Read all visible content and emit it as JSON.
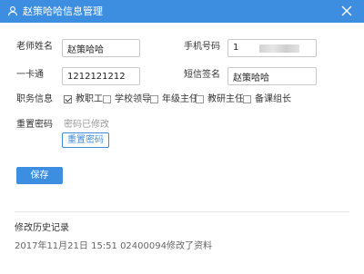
{
  "dialog": {
    "title": "赵策哈哈信息管理",
    "icons": {
      "title": "user-icon",
      "close": "close-icon"
    },
    "accent_color": "#3d8ee0"
  },
  "form": {
    "teacher_name": {
      "label": "老师姓名",
      "value": "赵策哈哈"
    },
    "phone": {
      "label": "手机号码",
      "value": "1"
    },
    "card": {
      "label": "一卡通",
      "value": "1212121212"
    },
    "sms_signature": {
      "label": "短信签名",
      "value": "赵策哈哈"
    },
    "position": {
      "label": "职务信息",
      "options": [
        {
          "label": "教职工",
          "checked": true
        },
        {
          "label": "学校领导",
          "checked": false
        },
        {
          "label": "年级主任",
          "checked": false
        },
        {
          "label": "教研主任",
          "checked": false
        },
        {
          "label": "备课组长",
          "checked": false
        }
      ]
    },
    "password": {
      "label": "重置密码",
      "status": "密码已修改",
      "button": "重置密码"
    },
    "save_button": "保存"
  },
  "history": {
    "title": "修改历史记录",
    "entries": [
      "2017年11月21日 15:51 02400094修改了资料"
    ]
  }
}
